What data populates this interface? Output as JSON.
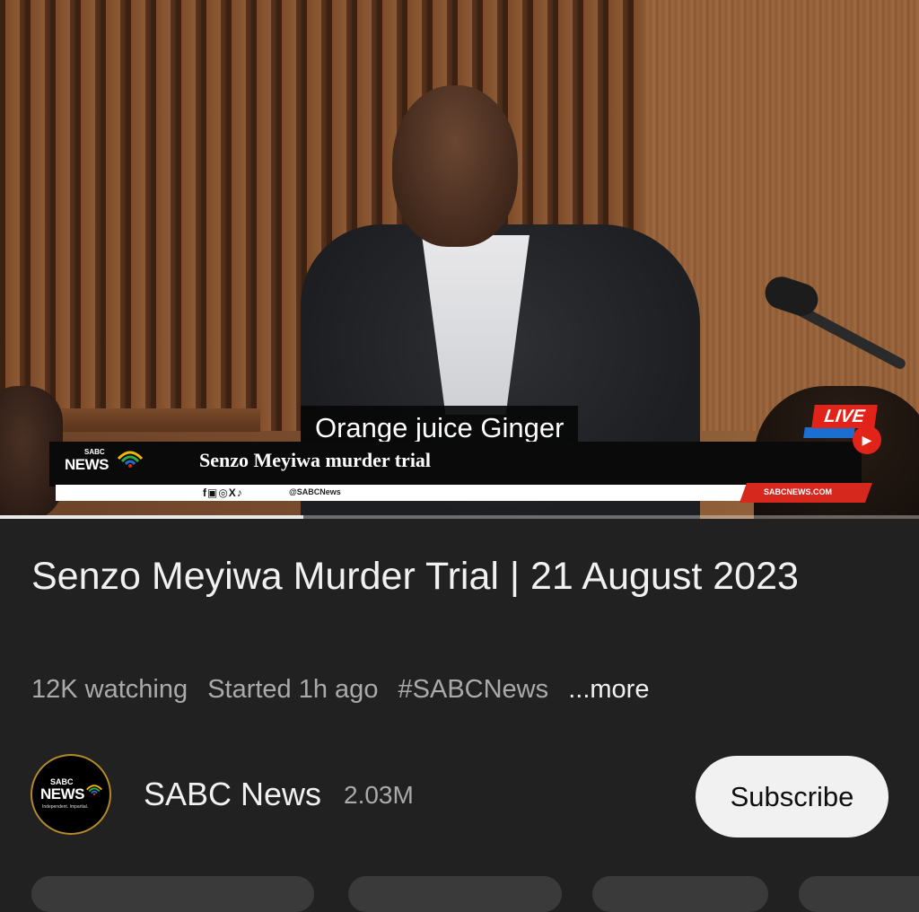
{
  "video": {
    "caption": "Orange juice Ginger",
    "lower_third": {
      "logo_small": "SABC",
      "logo_big": "NEWS",
      "headline": "Senzo Meyiwa murder trial",
      "social_icons": "f▣◎X♪",
      "handle": "@SABCNews",
      "site": "SABCNEWS.COM",
      "live": "LIVE"
    },
    "progress_fraction": 0.33
  },
  "info": {
    "title": "Senzo Meyiwa Murder Trial | 21 August 2023",
    "watching": "12K watching",
    "started": "Started 1h ago",
    "hashtag": "#SABCNews",
    "more": "...more"
  },
  "channel": {
    "avatar_small": "SABC",
    "avatar_big": "NEWS",
    "avatar_tagline": "Independent. Impartial.",
    "name": "SABC News",
    "subscribers": "2.03M",
    "subscribe_label": "Subscribe"
  },
  "colors": {
    "background": "#212121",
    "live_red": "#e2231a",
    "subscribe_bg": "#f1f1f1"
  }
}
